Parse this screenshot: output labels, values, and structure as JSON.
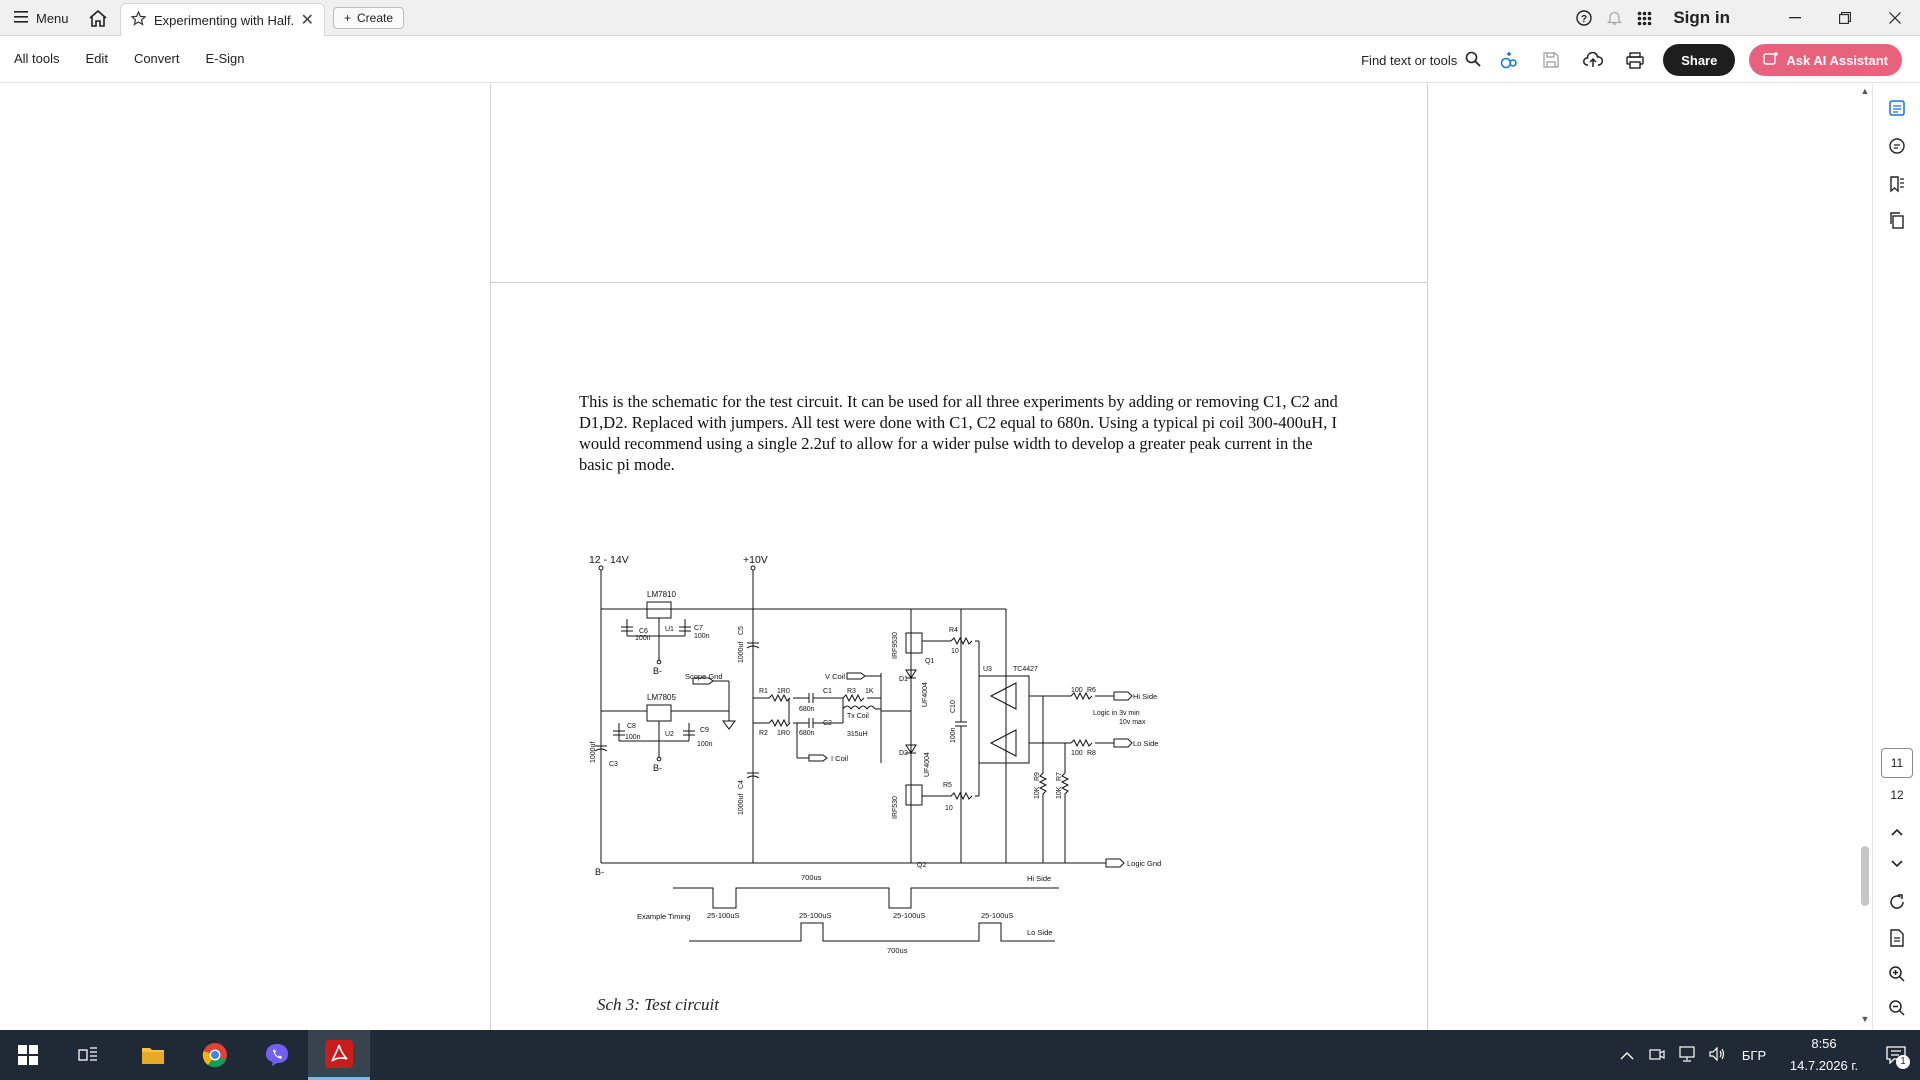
{
  "titlebar": {
    "menu_label": "Menu",
    "tab_title": "Experimenting with Half...",
    "create_label": "Create",
    "sign_in_label": "Sign in"
  },
  "toolbar": {
    "menu_items": [
      "All tools",
      "Edit",
      "Convert",
      "E-Sign"
    ],
    "find_label": "Find text or tools",
    "share_label": "Share",
    "ai_label": "Ask AI Assistant"
  },
  "document": {
    "paragraph": "This is the schematic for the test circuit. It can be used for all three experiments by adding or removing C1, C2 and D1,D2. Replaced with jumpers. All test were done with C1, C2 equal to 680n. Using a typical pi coil 300-400uH, I would recommend using a single 2.2uf to allow for a wider pulse width to develop a greater peak current in the basic pi mode.",
    "caption": "Sch 3: Test circuit",
    "schematic": {
      "supply_main": "12 - 14V",
      "supply_10v": "+10V",
      "reg1": "LM7810",
      "reg2": "LM7805",
      "neg1": "B-",
      "neg2": "B-",
      "neg3": "B-",
      "c6": "C6",
      "c6v": "100n",
      "c7": "C7",
      "c7v": "100n",
      "c8": "C8",
      "c8v": "100n",
      "c9": "C9",
      "c9v": "100n",
      "u1": "U1",
      "u2": "U2",
      "u3": "U3",
      "c3": "C3",
      "c3v": "1000uf",
      "c5": "C5",
      "c5v": "1000uf",
      "c4": "C4",
      "c4v": "1000uf",
      "scope": "Scope Gnd",
      "r1": "R1",
      "r1v": "1R0",
      "r2": "R2",
      "r2v": "1R0",
      "c1": "C1",
      "c1v": "680n",
      "c2": "C2",
      "c2v": "680n",
      "r3": "R3",
      "r3v": "1K",
      "txcoil": "Tx Coil",
      "txv": "315uH",
      "vcoil": "V Coil",
      "icoil": "I Coil",
      "q1": "Q1",
      "q1n": "IRF9530",
      "q2": "Q2",
      "q2n": "IRF530",
      "d1": "D1",
      "d1n": "UF4004",
      "d2": "D2",
      "d2n": "UF4004",
      "r4": "R4",
      "r4v": "10",
      "r5": "R5",
      "r5v": "10",
      "c10": "C10",
      "c10v": "100n",
      "tc": "TC4427",
      "r6": "R6",
      "r6v": "100",
      "r8": "R8",
      "r8v": "100",
      "r9": "R9",
      "r9v": "10K",
      "r7": "R7",
      "r7v": "10K",
      "hi_side": "Hi Side",
      "lo_side": "Lo Side",
      "logic_note1": "Logic in 3v min",
      "logic_note2": "10v max",
      "logic_gnd": "Logic Gnd",
      "timing_label": "Example Timing",
      "period_top": "700us",
      "period_bottom": "700us",
      "pulse_a": "25-100uS",
      "pulse_b": "25-100uS",
      "pulse_c": "25-100uS",
      "pulse_d": "25-100uS",
      "hi_side_t": "Hi Side",
      "lo_side_t": "Lo Side"
    }
  },
  "page_nav": {
    "current": "11",
    "total": "12"
  },
  "taskbar": {
    "language": "БГР",
    "time": "8:56",
    "date": "14.7.2026 г.",
    "notification_count": "1"
  },
  "colors": {
    "accent_blue": "#1473e6",
    "ai_pink": "#e8627e",
    "taskbar": "#1f2a36"
  }
}
